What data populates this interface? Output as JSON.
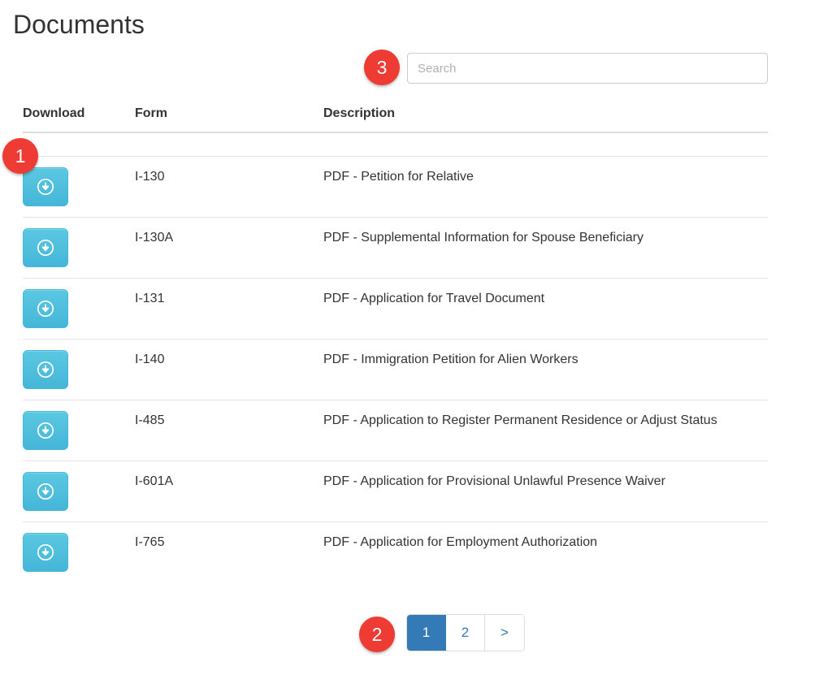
{
  "page": {
    "title": "Documents"
  },
  "search": {
    "placeholder": "Search",
    "value": ""
  },
  "table": {
    "headers": {
      "download": "Download",
      "form": "Form",
      "description": "Description"
    },
    "download_icon": "download-circle-icon",
    "rows": [
      {
        "form": "I-130",
        "description": "PDF - Petition for Relative"
      },
      {
        "form": "I-130A",
        "description": "PDF - Supplemental Information for Spouse Beneficiary"
      },
      {
        "form": "I-131",
        "description": "PDF - Application for Travel Document"
      },
      {
        "form": "I-140",
        "description": "PDF - Immigration Petition for Alien Workers"
      },
      {
        "form": "I-485",
        "description": "PDF - Application to Register Permanent Residence or Adjust Status"
      },
      {
        "form": "I-601A",
        "description": "PDF - Application for Provisional Unlawful Presence Waiver"
      },
      {
        "form": "I-765",
        "description": "PDF - Application for Employment Authorization"
      }
    ]
  },
  "pagination": {
    "items": [
      {
        "label": "1",
        "active": true
      },
      {
        "label": "2",
        "active": false
      },
      {
        "label": ">",
        "active": false
      }
    ]
  },
  "annotations": [
    {
      "id": "1",
      "label": "1"
    },
    {
      "id": "2",
      "label": "2"
    },
    {
      "id": "3",
      "label": "3"
    }
  ],
  "colors": {
    "accent_blue": "#337ab7",
    "download_cyan": "#45b6d8",
    "badge_red": "#ee3b33",
    "text": "#333333",
    "border": "#dddddd"
  }
}
